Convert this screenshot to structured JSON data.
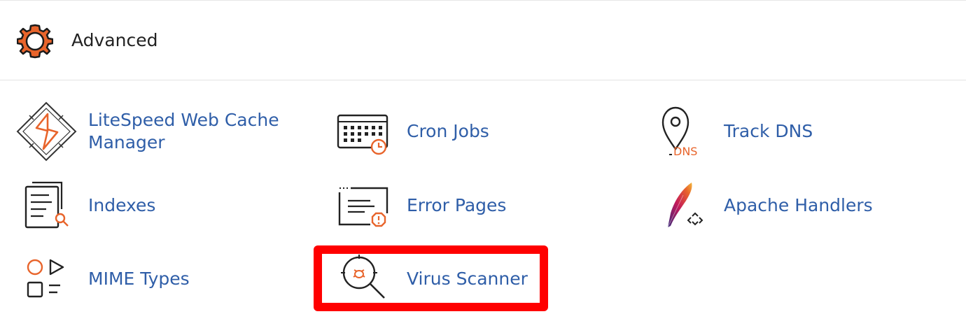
{
  "section": {
    "title": "Advanced",
    "icon": "gear-icon",
    "icon_color": "#e8642b"
  },
  "items": [
    {
      "label": "LiteSpeed Web Cache\nManager",
      "icon": "litespeed-icon"
    },
    {
      "label": "Cron Jobs",
      "icon": "calendar-clock-icon"
    },
    {
      "label": "Track DNS",
      "icon": "location-pin-dns-icon",
      "icon_text": "DNS"
    },
    {
      "label": "Indexes",
      "icon": "document-search-icon"
    },
    {
      "label": "Error Pages",
      "icon": "browser-warning-icon"
    },
    {
      "label": "Apache Handlers",
      "icon": "apache-feather-icon"
    },
    {
      "label": "MIME Types",
      "icon": "shapes-icon"
    },
    {
      "label": "Virus Scanner",
      "icon": "bug-magnifier-icon"
    }
  ],
  "colors": {
    "link": "#2f5ea8",
    "accent": "#e8642b",
    "highlight": "#ff0000"
  }
}
